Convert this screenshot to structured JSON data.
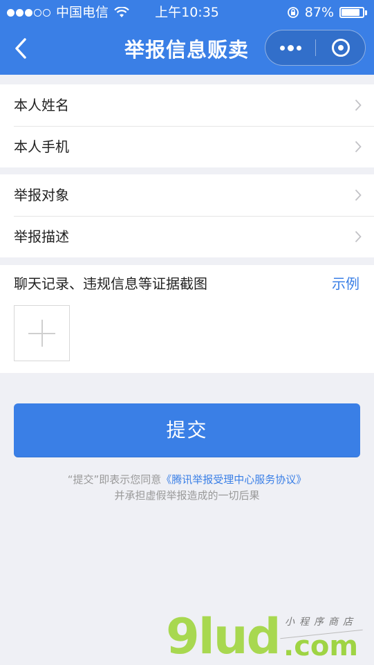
{
  "status_bar": {
    "carrier": "中国电信",
    "time": "上午10:35",
    "battery_percent_label": "87%",
    "battery_level": 0.87,
    "signal_bars_filled": 3,
    "signal_bars_total": 5
  },
  "nav": {
    "title": "举报信息贩卖"
  },
  "groups": [
    {
      "items": [
        "本人姓名",
        "本人手机"
      ]
    },
    {
      "items": [
        "举报对象",
        "举报描述"
      ]
    }
  ],
  "evidence": {
    "label": "聊天记录、违规信息等证据截图",
    "example_link": "示例"
  },
  "submit_label": "提交",
  "agreement": {
    "prefix": "“提交”即表示您同意",
    "link": "《腾讯举报受理中心服务协议》",
    "line2": "并承担虚假举报造成的一切后果"
  },
  "watermark": {
    "main": "9lud",
    "domain": ".com",
    "sub": "小程序商店"
  },
  "colors": {
    "primary": "#3a7fe6",
    "background": "#eff0f5",
    "watermark_green": "#a8d850"
  }
}
